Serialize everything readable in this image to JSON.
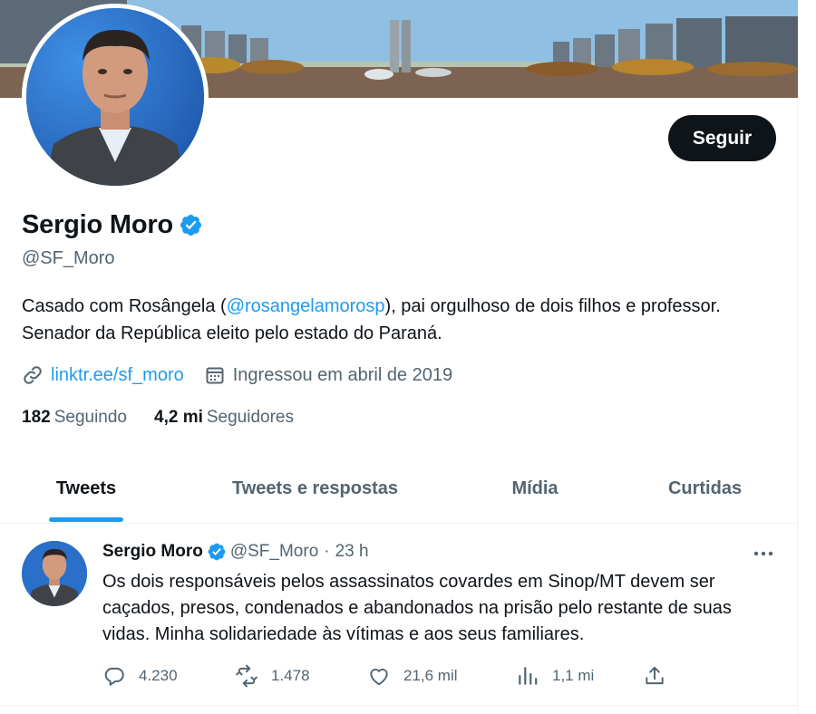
{
  "profile": {
    "display_name": "Sergio Moro",
    "handle": "@SF_Moro",
    "verified": true,
    "follow_label": "Seguir",
    "bio_prefix": "Casado com Rosângela (",
    "bio_mention": "@rosangelamorosp",
    "bio_suffix": "), pai orgulhoso de dois filhos e professor. Senador da República eleito pelo estado do Paraná.",
    "link": "linktr.ee/sf_moro",
    "joined": "Ingressou em abril de 2019",
    "following_count": "182",
    "following_label": "Seguindo",
    "followers_count": "4,2 mi",
    "followers_label": "Seguidores"
  },
  "tabs": [
    {
      "label": "Tweets",
      "active": true
    },
    {
      "label": "Tweets e respostas",
      "active": false
    },
    {
      "label": "Mídia",
      "active": false
    },
    {
      "label": "Curtidas",
      "active": false
    }
  ],
  "tweet": {
    "name": "Sergio Moro",
    "handle": "@SF_Moro",
    "separator": "·",
    "time": "23 h",
    "text": "Os dois responsáveis pelos assassinatos covardes em Sinop/MT devem ser caçados, presos, condenados e abandonados na prisão pelo restante de suas vidas. Minha solidariedade às vítimas e aos seus familiares.",
    "replies": "4.230",
    "retweets": "1.478",
    "likes": "21,6 mil",
    "views": "1,1 mi"
  },
  "icons": {
    "verified": "verified-badge-icon",
    "link": "link-icon",
    "calendar": "calendar-icon",
    "more": "more-icon",
    "reply": "reply-icon",
    "retweet": "retweet-icon",
    "like": "heart-icon",
    "views": "views-icon",
    "share": "share-icon"
  },
  "colors": {
    "accent": "#1d9bf0",
    "text": "#0f1419",
    "muted": "#536471",
    "button": "#0f1419"
  }
}
